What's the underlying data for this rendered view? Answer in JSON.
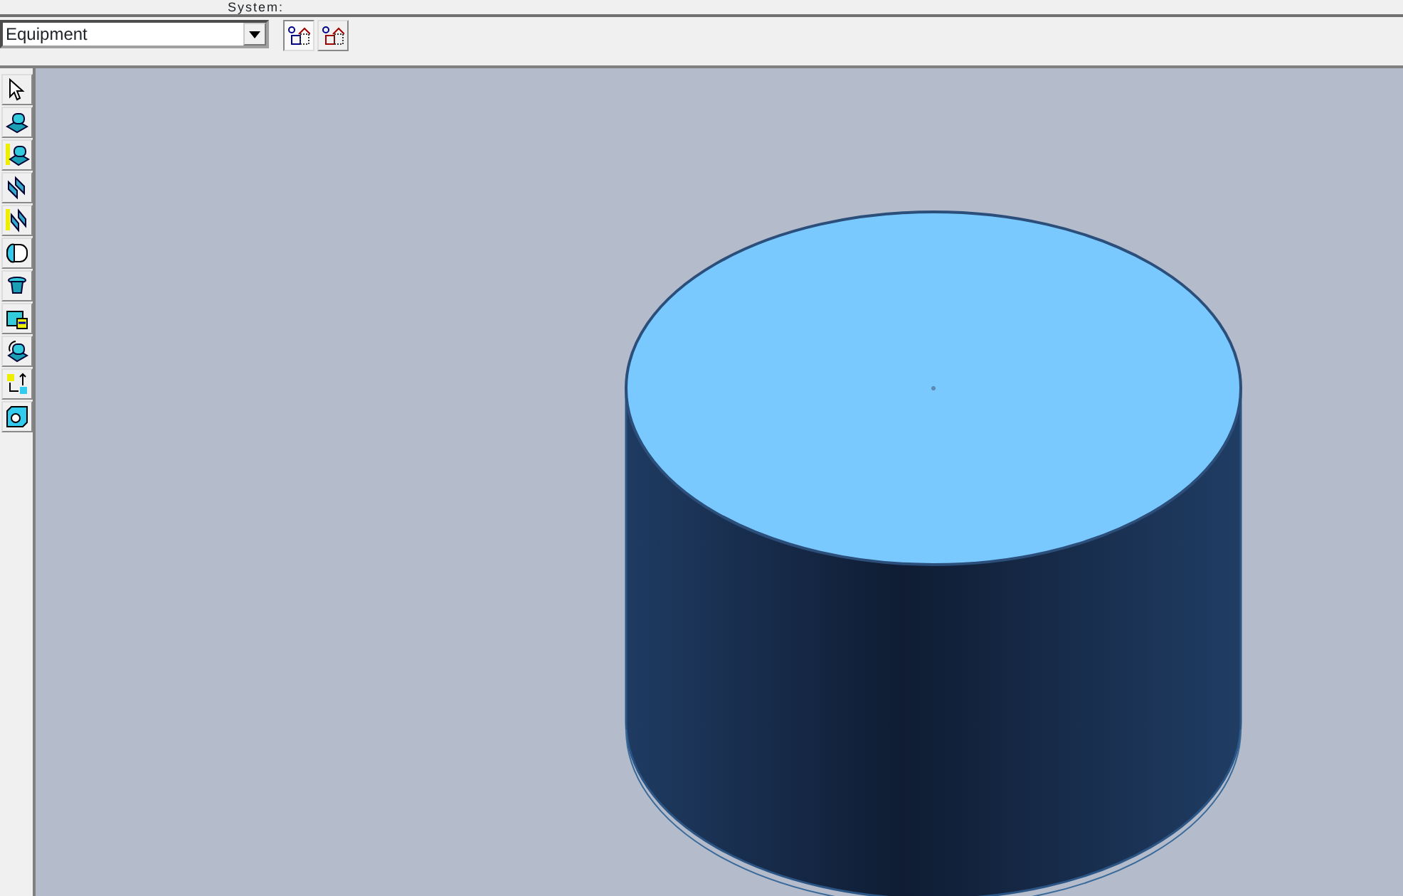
{
  "top_toolbar": {
    "label": "System:"
  },
  "filter_toolbar": {
    "combo": {
      "value": "Equipment"
    },
    "buttons": [
      {
        "kind": "blue",
        "selected": true
      },
      {
        "kind": "red",
        "selected": false
      }
    ]
  },
  "tool_palette": [
    {
      "kind": "pointer"
    },
    {
      "kind": "equipment"
    },
    {
      "kind": "equipment-ruler"
    },
    {
      "kind": "plates"
    },
    {
      "kind": "plates-ruler"
    },
    {
      "kind": "cylinder"
    },
    {
      "kind": "nozzle"
    },
    {
      "kind": "box-arrow"
    },
    {
      "kind": "rotate"
    },
    {
      "kind": "connect"
    },
    {
      "kind": "cube"
    }
  ]
}
